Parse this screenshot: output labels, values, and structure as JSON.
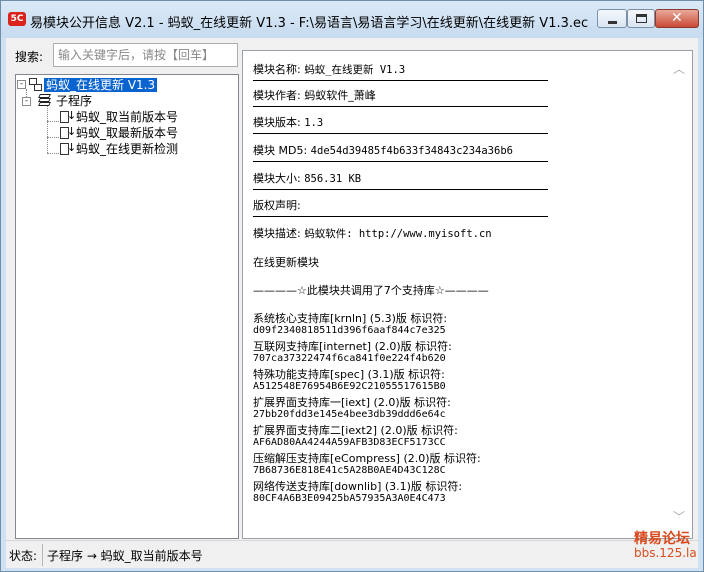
{
  "window": {
    "icon_text": "5C",
    "title": "易模块公开信息 V2.1 - 蚂蚁_在线更新 V1.3 - F:\\易语言\\易语言学习\\在线更新\\在线更新 V1.3.ec"
  },
  "search": {
    "label": "搜索:",
    "placeholder": "输入关键字后，请按【回车】"
  },
  "tree": {
    "root": "蚂蚁_在线更新 V1.3",
    "group": "子程序",
    "toggle_root": "-",
    "toggle_group": "-",
    "items": [
      "蚂蚁_取当前版本号",
      "蚂蚁_取最新版本号",
      "蚂蚁_在线更新检测"
    ]
  },
  "info": {
    "name_label": "模块名称:",
    "name_value": "蚂蚁_在线更新 V1.3",
    "author_label": "模块作者:",
    "author_value": "蚂蚁软件_萧峰",
    "version_label": "模块版本:",
    "version_value": "1.3",
    "md5_label": "模块 MD5:",
    "md5_value": "4de54d39485f4b633f34843c234a36b6",
    "size_label": "模块大小:",
    "size_value": "856.31 KB",
    "copyright_label": "版权声明:",
    "desc_label": "模块描述:",
    "desc_value": "蚂蚁软件: http://www.myisoft.cn",
    "desc_extra": "在线更新模块",
    "libs_heading": "————☆此模块共调用了7个支持库☆————"
  },
  "libraries": [
    {
      "name": "系统核心支持库[krnln] (5.3)版 标识符:",
      "id": "d09f2340818511d396f6aaf844c7e325"
    },
    {
      "name": "互联网支持库[internet] (2.0)版 标识符:",
      "id": "707ca37322474f6ca841f0e224f4b620"
    },
    {
      "name": "特殊功能支持库[spec] (3.1)版 标识符:",
      "id": "A512548E76954B6E92C21055517615B0"
    },
    {
      "name": "扩展界面支持库一[iext] (2.0)版 标识符:",
      "id": "27bb20fdd3e145e4bee3db39ddd6e64c"
    },
    {
      "name": "扩展界面支持库二[iext2] (2.0)版 标识符:",
      "id": "AF6AD80AA4244A59AFB3D83ECF5173CC"
    },
    {
      "name": "压缩解压支持库[eCompress] (2.0)版 标识符:",
      "id": "7B68736E818E41c5A28B0AE4D43C128C"
    },
    {
      "name": "网络传送支持库[downlib] (3.1)版 标识符:",
      "id": "80CF4A6B3E09425bA57935A3A0E4C473"
    }
  ],
  "status": {
    "label": "状态:",
    "text": "子程序 → 蚂蚁_取当前版本号"
  },
  "watermark": {
    "line1": "精易论坛",
    "line2": "bbs.125.la"
  },
  "colors": {
    "selection": "#0a64cf",
    "watermark": "#d94b1e",
    "titlebar": "#c6dbef"
  }
}
